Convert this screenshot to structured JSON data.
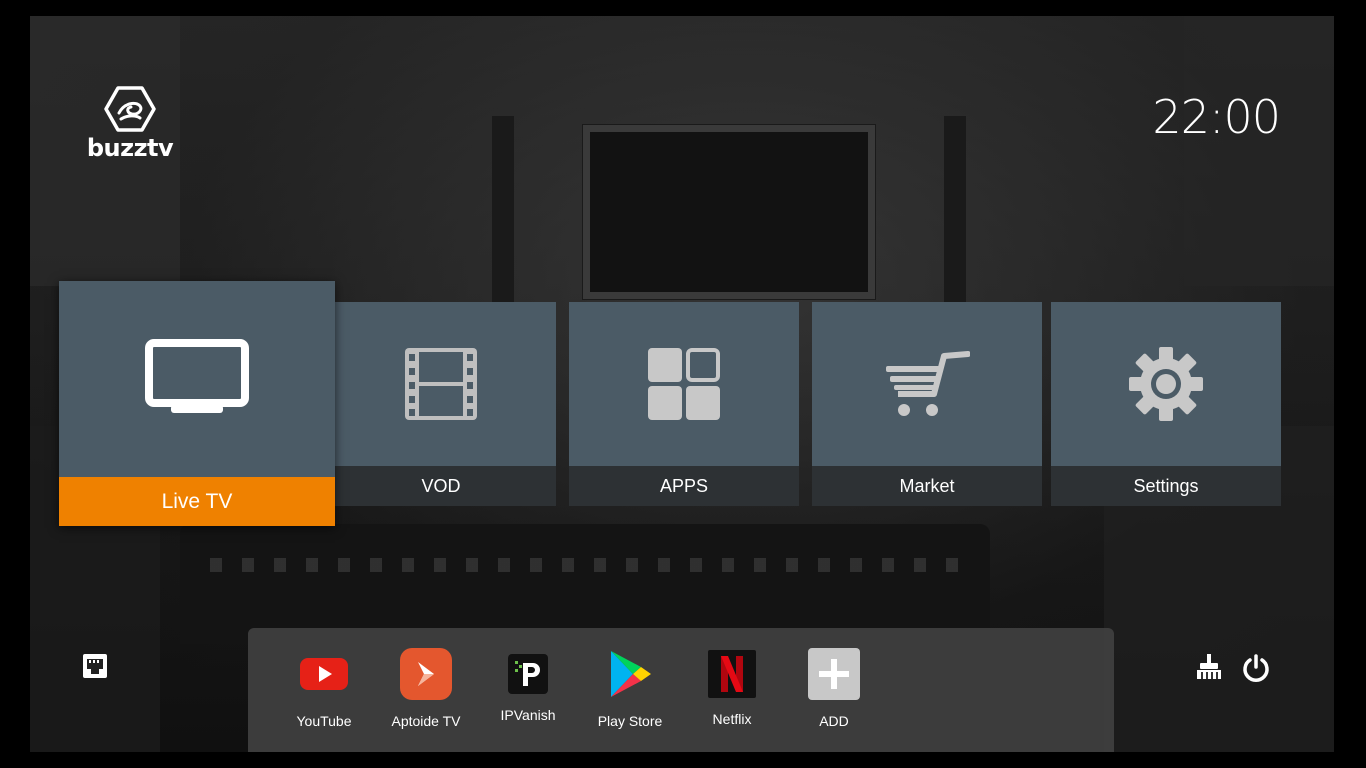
{
  "brand": {
    "logo_text": "buzztv"
  },
  "clock": {
    "time": "22:00"
  },
  "menu": {
    "tiles": [
      {
        "label": "Live TV",
        "icon": "tv-icon",
        "selected": true
      },
      {
        "label": "VOD",
        "icon": "film-icon"
      },
      {
        "label": "APPS",
        "icon": "apps-grid-icon"
      },
      {
        "label": "Market",
        "icon": "cart-icon"
      },
      {
        "label": "Settings",
        "icon": "gear-icon"
      }
    ],
    "accent_color": "#ef8100",
    "tile_color": "#4b5b66"
  },
  "dock": {
    "apps": [
      {
        "label": "YouTube",
        "icon": "youtube-icon"
      },
      {
        "label": "Aptoide TV",
        "icon": "aptoide-icon"
      },
      {
        "label": "IPVanish",
        "icon": "ipvanish-icon"
      },
      {
        "label": "Play Store",
        "icon": "play-store-icon"
      },
      {
        "label": "Netflix",
        "icon": "netflix-icon"
      },
      {
        "label": "ADD",
        "icon": "add-icon"
      }
    ]
  },
  "status": {
    "network_icon": "ethernet-icon",
    "clean_icon": "broom-icon",
    "power_icon": "power-icon"
  }
}
